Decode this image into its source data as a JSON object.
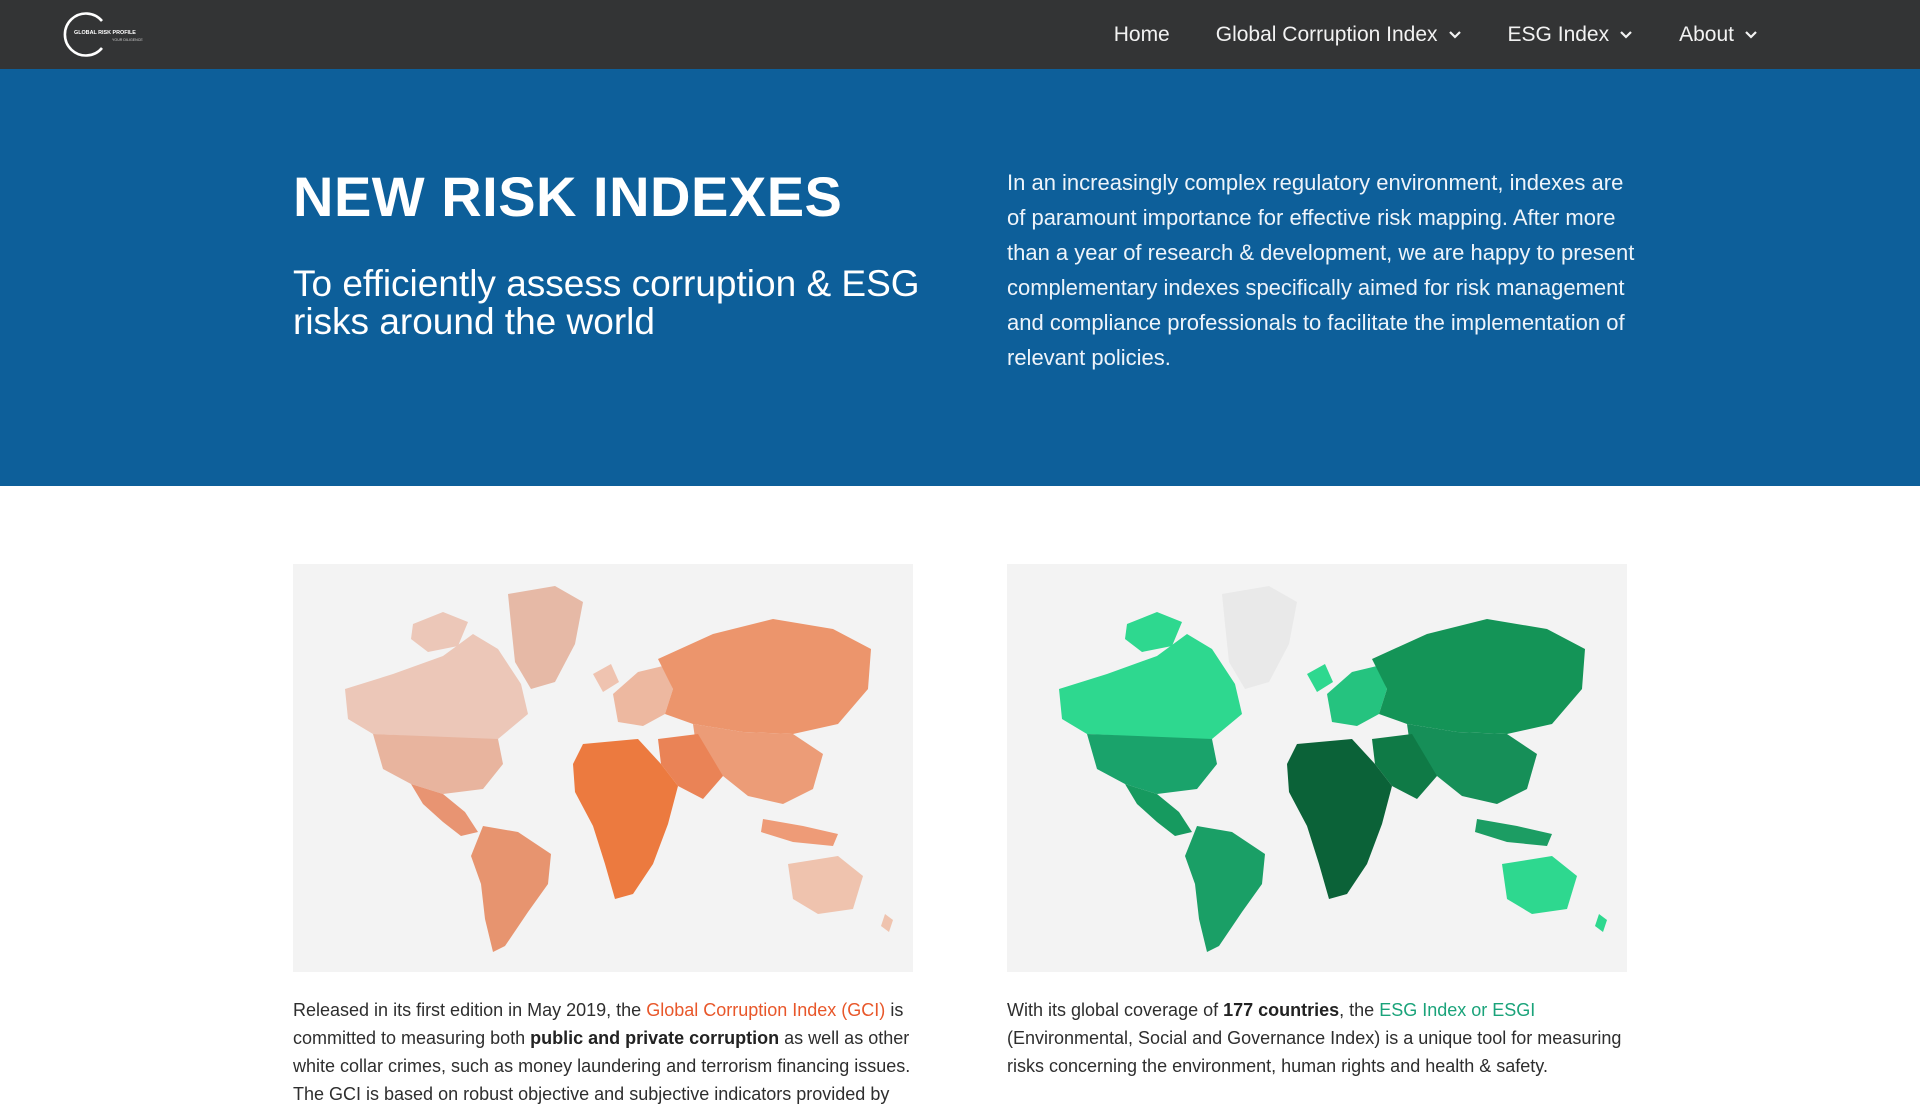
{
  "logo": {
    "text_line1": "GLOBAL RISK PROFILE",
    "text_line2": "YOUR DILIGENCE"
  },
  "nav": {
    "home": "Home",
    "gci": "Global Corruption Index",
    "esg": "ESG Index",
    "about": "About"
  },
  "hero": {
    "title": "NEW RISK INDEXES",
    "subtitle": "To efficiently assess corruption & ESG risks around the world",
    "text": "In an increasingly complex regulatory environment,  indexes are of paramount importance for effective risk mapping. After more than a year of research & development, we are happy to present complementary indexes specifically aimed for risk management and compliance professionals to facilitate the implementation of relevant policies."
  },
  "left": {
    "p1": "Released in its first edition in May 2019, the ",
    "link": "Global Corruption Index (GCI)",
    "p2": " is committed to measuring both ",
    "bold": "public and private corruption",
    "p3": " as well as other white collar crimes, such as money laundering and terrorism financing issues. The GCI is based on robust objective and subjective indicators provided by"
  },
  "right": {
    "p1": "With its global coverage of ",
    "bold": "177 countries",
    "p2": ", the ",
    "link": "ESG Index or ESGI",
    "p3": " (Environmental, Social and Governance Index) is a unique tool for measuring risks concerning the environment, human rights and health & safety."
  },
  "colors": {
    "nav_bg": "#333435",
    "hero_bg": "#0d5f9a",
    "gci_accent": "#e8572a",
    "esg_accent": "#1aa37a"
  }
}
